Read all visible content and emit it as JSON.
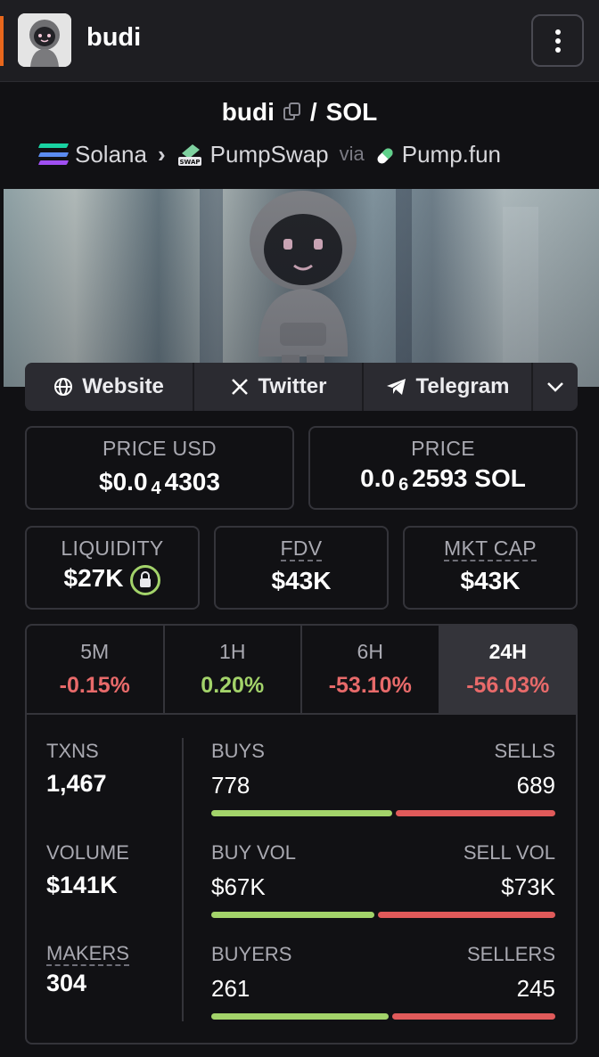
{
  "header": {
    "title": "budi"
  },
  "pair": {
    "base": "budi",
    "separator": "/",
    "quote": "SOL"
  },
  "route": {
    "chain": "Solana",
    "dex": "PumpSwap",
    "via_label": "via",
    "launchpad": "Pump.fun"
  },
  "links": [
    {
      "label": "Website",
      "icon": "globe-icon"
    },
    {
      "label": "Twitter",
      "icon": "x-logo-icon"
    },
    {
      "label": "Telegram",
      "icon": "telegram-icon"
    }
  ],
  "price_usd": {
    "label": "PRICE USD",
    "prefix": "$0.0",
    "zeros": "4",
    "digits": "4303"
  },
  "price_native": {
    "label": "PRICE",
    "prefix": "0.0",
    "zeros": "6",
    "digits": "2593 SOL"
  },
  "liquidity": {
    "label": "LIQUIDITY",
    "value": "$27K"
  },
  "fdv": {
    "label": "FDV",
    "value": "$43K"
  },
  "mkt_cap": {
    "label": "MKT CAP",
    "value": "$43K"
  },
  "timeframes": [
    {
      "label": "5M",
      "change": "-0.15%",
      "color": "#e86a6a"
    },
    {
      "label": "1H",
      "change": "0.20%",
      "color": "#a3d36a"
    },
    {
      "label": "6H",
      "change": "-53.10%",
      "color": "#e86a6a"
    },
    {
      "label": "24H",
      "change": "-56.03%",
      "color": "#e86a6a",
      "active": true
    }
  ],
  "txns": {
    "label": "TXNS",
    "value": "1,467"
  },
  "volume": {
    "label": "VOLUME",
    "value": "$141K"
  },
  "makers": {
    "label": "MAKERS",
    "value": "304"
  },
  "buys_sells": {
    "left_label": "BUYS",
    "right_label": "SELLS",
    "left_value": "778",
    "right_value": "689",
    "buy_fraction": 0.53
  },
  "vol_split": {
    "left_label": "BUY VOL",
    "right_label": "SELL VOL",
    "left_value": "$67K",
    "right_value": "$73K",
    "buy_fraction": 0.48
  },
  "buyers_sellers": {
    "left_label": "BUYERS",
    "right_label": "SELLERS",
    "left_value": "261",
    "right_value": "245",
    "buy_fraction": 0.52
  },
  "colors": {
    "accent": "#e8671c",
    "positive": "#a3d36a",
    "negative": "#e05a5a"
  }
}
